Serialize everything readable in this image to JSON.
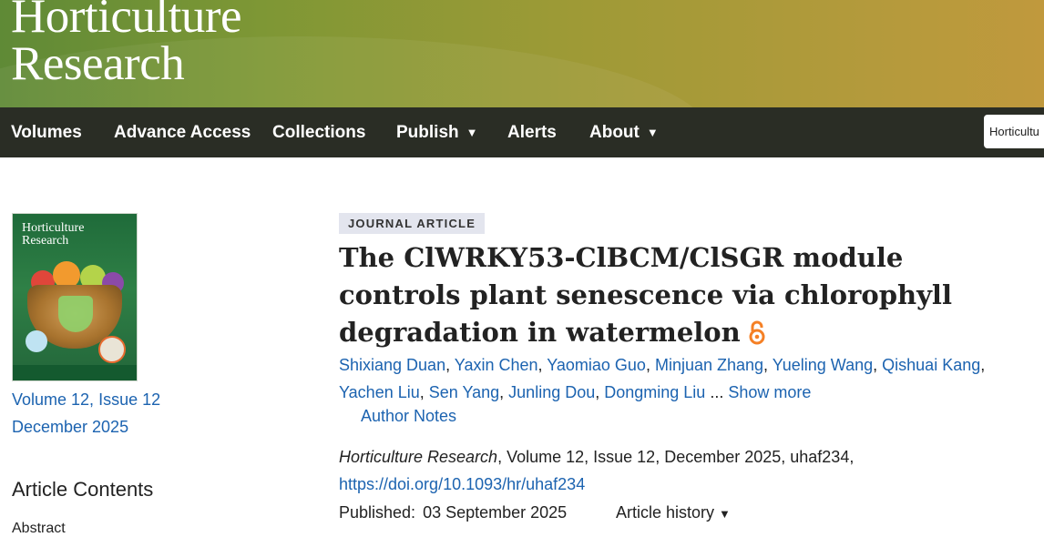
{
  "brand": {
    "line1": "Horticulture",
    "line2": "Research"
  },
  "nav": {
    "items": [
      {
        "label": "Volumes",
        "has_dropdown": false
      },
      {
        "label": "Advance Access",
        "has_dropdown": false
      },
      {
        "label": "Collections",
        "has_dropdown": false
      },
      {
        "label": "Publish",
        "has_dropdown": true
      },
      {
        "label": "Alerts",
        "has_dropdown": false
      },
      {
        "label": "About",
        "has_dropdown": true
      }
    ],
    "search_value": "Horticultu",
    "dropdown_glyph": "▼"
  },
  "sidebar": {
    "cover_title_line1": "Horticulture",
    "cover_title_line2": "Research",
    "volume_issue": "Volume 12, Issue 12",
    "issue_date": "December 2025",
    "contents_title": "Article Contents",
    "contents_first_item": "Abstract"
  },
  "article": {
    "type_badge": "JOURNAL ARTICLE",
    "title": "The ClWRKY53-ClBCM/ClSGR module controls plant senescence via chlorophyll degradation in watermelon",
    "open_access_icon": "open-access-lock",
    "authors": [
      "Shixiang Duan",
      "Yaxin Chen",
      "Yaomiao Guo",
      "Minjuan Zhang",
      "Yueling Wang",
      "Qishuai Kang",
      "Yachen Liu",
      "Sen Yang",
      "Junling Dou",
      "Dongming Liu"
    ],
    "authors_ellipsis": "...",
    "show_more": "Show more",
    "author_notes": "Author Notes",
    "citation_journal": "Horticulture Research",
    "citation_rest": ", Volume 12, Issue 12, December 2025, uhaf234,",
    "doi": "https://doi.org/10.1093/hr/uhaf234",
    "published_label": "Published:",
    "published_date": "03 September 2025",
    "history_label": "Article history",
    "history_glyph": "▼"
  },
  "colors": {
    "link": "#1c63b0",
    "nav_bg": "#2a2d25",
    "banner_start": "#5f8a36",
    "banner_end": "#c0993d",
    "badge_bg": "#e3e5ee"
  }
}
